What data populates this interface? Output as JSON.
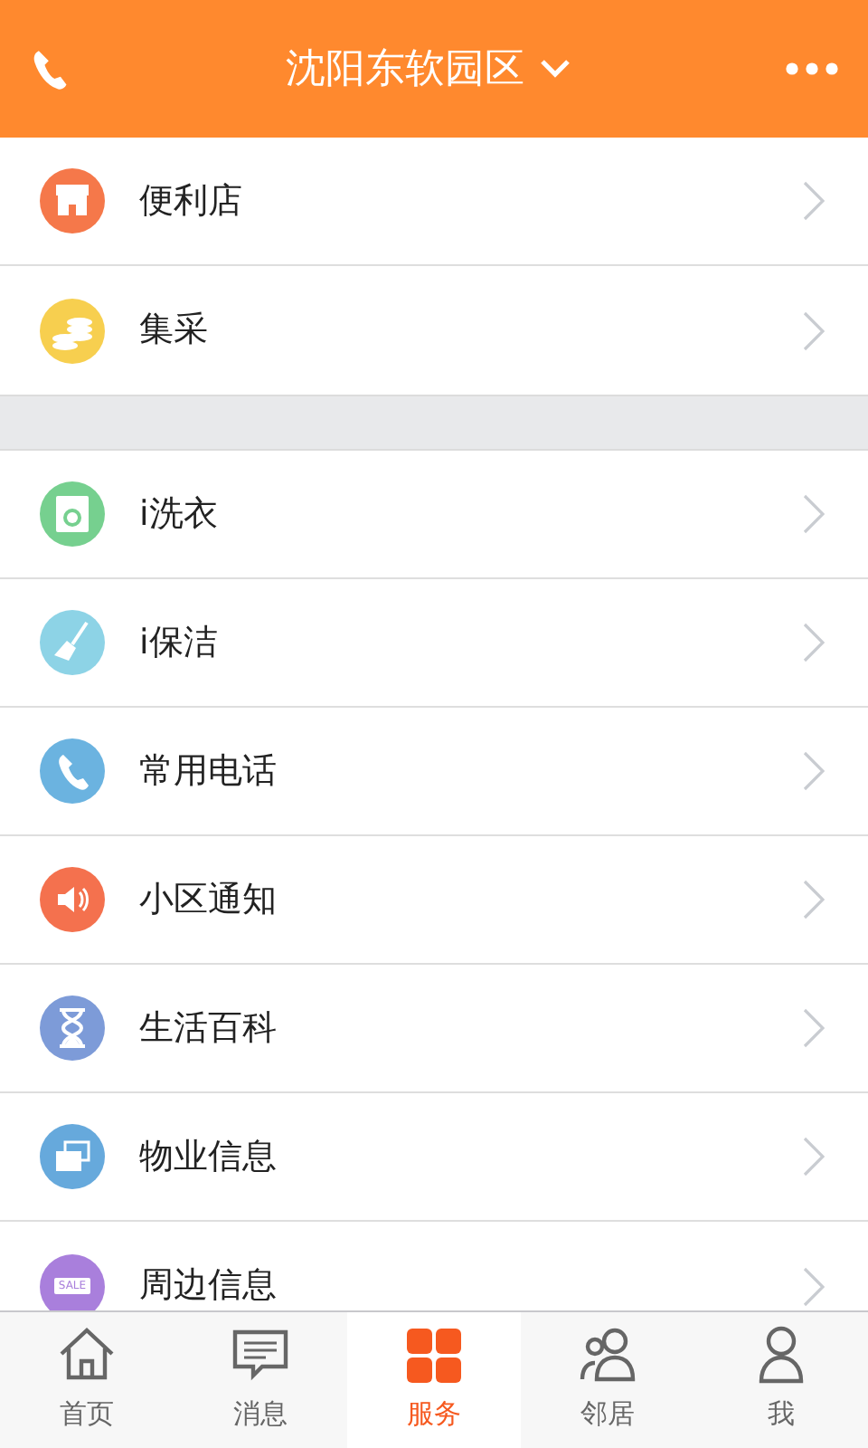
{
  "header": {
    "title": "沈阳东软园区"
  },
  "groups": [
    {
      "items": [
        {
          "label": "便利店",
          "kind": "store",
          "color": "#f5784a"
        },
        {
          "label": "集采",
          "kind": "coins",
          "color": "#f7cf4f"
        }
      ]
    },
    {
      "items": [
        {
          "label": "i洗衣",
          "kind": "washer",
          "color": "#76d08f"
        },
        {
          "label": "i保洁",
          "kind": "broom",
          "color": "#8dd3e6"
        },
        {
          "label": "常用电话",
          "kind": "phone",
          "color": "#6bb3e0"
        },
        {
          "label": "小区通知",
          "kind": "speaker",
          "color": "#f4714e"
        },
        {
          "label": "生活百科",
          "kind": "hourglass",
          "color": "#7d9bd8"
        },
        {
          "label": "物业信息",
          "kind": "cards",
          "color": "#66a9dc"
        },
        {
          "label": "周边信息",
          "kind": "sale",
          "color": "#a97fdc",
          "icon_text": "SALE"
        }
      ]
    }
  ],
  "tabbar": [
    {
      "label": "首页",
      "kind": "home",
      "selected": false
    },
    {
      "label": "消息",
      "kind": "message",
      "selected": false
    },
    {
      "label": "服务",
      "kind": "grid",
      "selected": true
    },
    {
      "label": "邻居",
      "kind": "people",
      "selected": false
    },
    {
      "label": "我",
      "kind": "person",
      "selected": false
    }
  ]
}
